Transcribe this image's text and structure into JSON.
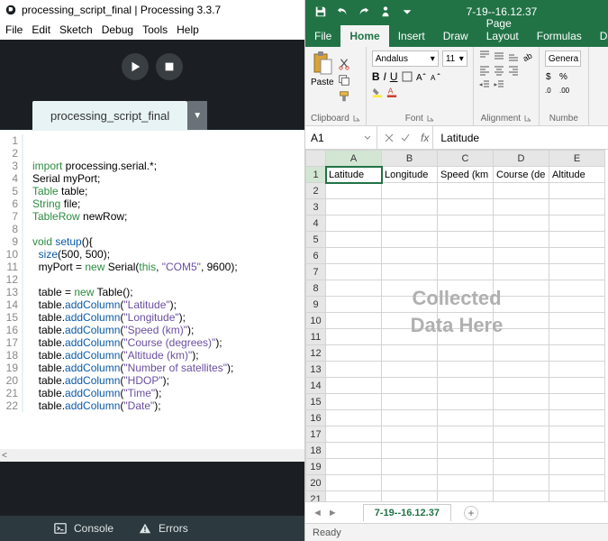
{
  "processing": {
    "title": "processing_script_final | Processing 3.3.7",
    "menu": [
      "File",
      "Edit",
      "Sketch",
      "Debug",
      "Tools",
      "Help"
    ],
    "tab_name": "processing_script_final",
    "scroll_hint": "<",
    "bottom": {
      "console": "Console",
      "errors": "Errors"
    },
    "code": [
      {
        "n": 1,
        "t": ""
      },
      {
        "n": 2,
        "t": ""
      },
      {
        "n": 3,
        "tokens": [
          [
            "kw",
            "import"
          ],
          [
            "",
            " processing.serial.*;"
          ]
        ]
      },
      {
        "n": 4,
        "tokens": [
          [
            "",
            "Serial myPort;"
          ]
        ]
      },
      {
        "n": 5,
        "tokens": [
          [
            "kw",
            "Table"
          ],
          [
            "",
            " table;"
          ]
        ]
      },
      {
        "n": 6,
        "tokens": [
          [
            "kw",
            "String"
          ],
          [
            "",
            " file;"
          ]
        ]
      },
      {
        "n": 7,
        "tokens": [
          [
            "kw",
            "TableRow"
          ],
          [
            "",
            " newRow;"
          ]
        ]
      },
      {
        "n": 8,
        "t": ""
      },
      {
        "n": 9,
        "tokens": [
          [
            "kw",
            "void"
          ],
          [
            "",
            " "
          ],
          [
            "fn",
            "setup"
          ],
          [
            "",
            "(){"
          ]
        ]
      },
      {
        "n": 10,
        "tokens": [
          [
            "",
            "  "
          ],
          [
            "fn",
            "size"
          ],
          [
            "",
            "(500, 500);"
          ]
        ]
      },
      {
        "n": 11,
        "tokens": [
          [
            "",
            "  myPort = "
          ],
          [
            "kw",
            "new"
          ],
          [
            "",
            " Serial("
          ],
          [
            "kw",
            "this"
          ],
          [
            "",
            ", "
          ],
          [
            "str",
            "\"COM5\""
          ],
          [
            "",
            ", 9600);"
          ]
        ]
      },
      {
        "n": 12,
        "t": ""
      },
      {
        "n": 13,
        "tokens": [
          [
            "",
            "  table = "
          ],
          [
            "kw",
            "new"
          ],
          [
            "",
            " Table();"
          ]
        ]
      },
      {
        "n": 14,
        "tokens": [
          [
            "",
            "  table."
          ],
          [
            "fn",
            "addColumn"
          ],
          [
            "",
            "("
          ],
          [
            "str",
            "\"Latitude\""
          ],
          [
            "",
            ");"
          ]
        ]
      },
      {
        "n": 15,
        "tokens": [
          [
            "",
            "  table."
          ],
          [
            "fn",
            "addColumn"
          ],
          [
            "",
            "("
          ],
          [
            "str",
            "\"Longitude\""
          ],
          [
            "",
            ");"
          ]
        ]
      },
      {
        "n": 16,
        "tokens": [
          [
            "",
            "  table."
          ],
          [
            "fn",
            "addColumn"
          ],
          [
            "",
            "("
          ],
          [
            "str",
            "\"Speed (km)\""
          ],
          [
            "",
            ");"
          ]
        ]
      },
      {
        "n": 17,
        "tokens": [
          [
            "",
            "  table."
          ],
          [
            "fn",
            "addColumn"
          ],
          [
            "",
            "("
          ],
          [
            "str",
            "\"Course (degrees)\""
          ],
          [
            "",
            ");"
          ]
        ]
      },
      {
        "n": 18,
        "tokens": [
          [
            "",
            "  table."
          ],
          [
            "fn",
            "addColumn"
          ],
          [
            "",
            "("
          ],
          [
            "str",
            "\"Altitude (km)\""
          ],
          [
            "",
            ");"
          ]
        ]
      },
      {
        "n": 19,
        "tokens": [
          [
            "",
            "  table."
          ],
          [
            "fn",
            "addColumn"
          ],
          [
            "",
            "("
          ],
          [
            "str",
            "\"Number of satellites\""
          ],
          [
            "",
            ");"
          ]
        ]
      },
      {
        "n": 20,
        "tokens": [
          [
            "",
            "  table."
          ],
          [
            "fn",
            "addColumn"
          ],
          [
            "",
            "("
          ],
          [
            "str",
            "\"HDOP\""
          ],
          [
            "",
            ");"
          ]
        ]
      },
      {
        "n": 21,
        "tokens": [
          [
            "",
            "  table."
          ],
          [
            "fn",
            "addColumn"
          ],
          [
            "",
            "("
          ],
          [
            "str",
            "\"Time\""
          ],
          [
            "",
            ");"
          ]
        ]
      },
      {
        "n": 22,
        "tokens": [
          [
            "",
            "  table."
          ],
          [
            "fn",
            "addColumn"
          ],
          [
            "",
            "("
          ],
          [
            "str",
            "\"Date\""
          ],
          [
            "",
            ");"
          ]
        ]
      }
    ]
  },
  "excel": {
    "filename": "7-19--16.12.37",
    "ribbon_tabs": [
      "File",
      "Home",
      "Insert",
      "Draw",
      "Page Layout",
      "Formulas",
      "Dat"
    ],
    "active_tab": "Home",
    "groups": {
      "clipboard": "Clipboard",
      "font": "Font",
      "alignment": "Alignment",
      "number": "Numbe"
    },
    "font": {
      "name": "Andalus",
      "size": "11"
    },
    "number_fmt": "Genera",
    "paste_label": "Paste",
    "namebox": "A1",
    "formula_value": "Latitude",
    "columns": [
      "A",
      "B",
      "C",
      "D",
      "E"
    ],
    "headers": [
      "Latitude",
      "Longitude",
      "Speed (km",
      "Course (de",
      "Altitude"
    ],
    "row_count": 21,
    "watermark1": "Collected",
    "watermark2": "Data Here",
    "sheet_name": "7-19--16.12.37",
    "status": "Ready"
  },
  "icons": {
    "biu": {
      "b": "B",
      "i": "I",
      "u": "U"
    }
  }
}
